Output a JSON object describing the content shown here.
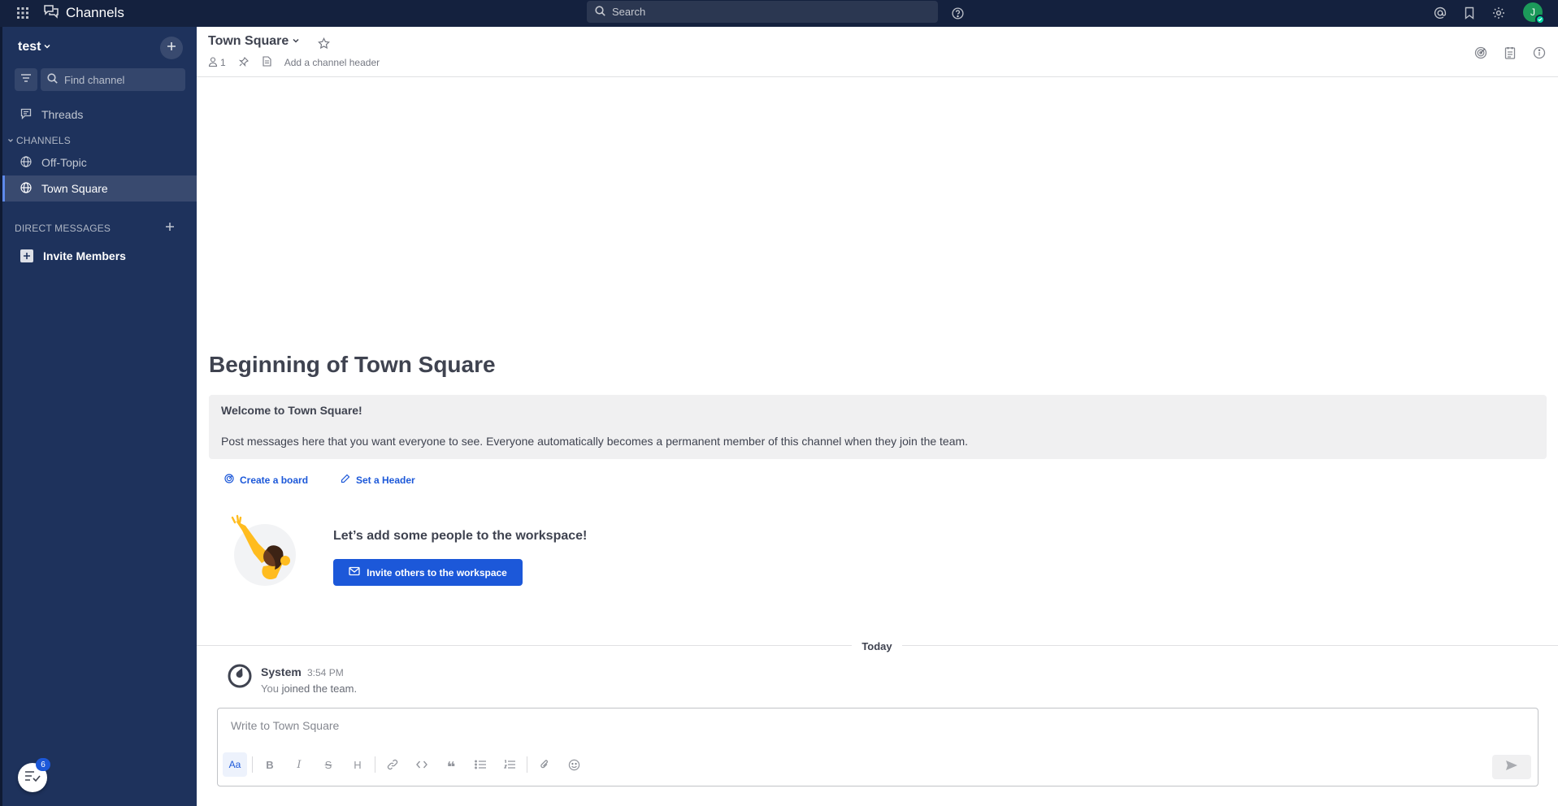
{
  "topbar": {
    "product_name": "Channels",
    "search_placeholder": "Search"
  },
  "sidebar": {
    "team_name": "test",
    "find_channel_placeholder": "Find channel",
    "threads_label": "Threads",
    "channels_section": "CHANNELS",
    "channels": [
      {
        "label": "Off-Topic",
        "active": false
      },
      {
        "label": "Town Square",
        "active": true
      }
    ],
    "dm_section": "DIRECT MESSAGES",
    "invite_members": "Invite Members",
    "todo_badge": "6"
  },
  "channel": {
    "name": "Town Square",
    "member_count": "1",
    "header_placeholder": "Add a channel header"
  },
  "intro": {
    "title": "Beginning of Town Square",
    "welcome": "Welcome to Town Square!",
    "description": "Post messages here that you want everyone to see. Everyone automatically becomes a permanent member of this channel when they join the team.",
    "create_board": "Create a board",
    "set_header": "Set a Header",
    "add_people": "Let’s add some people to the workspace!",
    "invite_button": "Invite others to the workspace"
  },
  "date_separator": "Today",
  "post": {
    "user": "System",
    "time": "3:54 PM",
    "msg_prefix": "You",
    "msg_rest": "joined the team."
  },
  "composer": {
    "placeholder": "Write to Town Square"
  },
  "colors": {
    "topbar_bg": "#14213e",
    "sidebar_bg": "#1e325c",
    "accent": "#1c58d9",
    "online": "#06d6a0"
  }
}
